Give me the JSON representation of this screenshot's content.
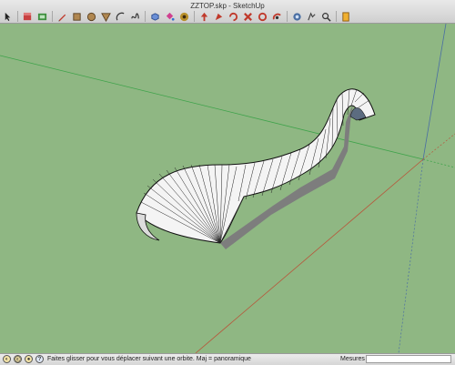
{
  "window": {
    "title": "ZZTOP.skp - SketchUp"
  },
  "toolbar": {
    "tools": [
      {
        "name": "select-tool-icon"
      },
      {
        "name": "eraser-tool-icon"
      },
      {
        "name": "make-component-icon"
      },
      {
        "name": "pencil-tool-icon"
      },
      {
        "name": "rectangle-tool-icon"
      },
      {
        "name": "circle-tool-icon"
      },
      {
        "name": "polygon-tool-icon"
      },
      {
        "name": "arc-tool-icon"
      },
      {
        "name": "freehand-tool-icon"
      },
      {
        "name": "push-pull-tool-icon"
      },
      {
        "name": "paint-bucket-tool-icon"
      },
      {
        "name": "move-tool-icon"
      },
      {
        "name": "push-pull-3d-tool-icon"
      },
      {
        "name": "follow-me-tool-icon"
      },
      {
        "name": "rotate-tool-icon"
      },
      {
        "name": "scale-tool-icon"
      },
      {
        "name": "offset-tool-icon"
      },
      {
        "name": "orbit-tool-icon"
      },
      {
        "name": "pan-tool-icon"
      },
      {
        "name": "zoom-tool-icon"
      },
      {
        "name": "section-tool-icon"
      }
    ]
  },
  "statusbar": {
    "message": "Faites glisser pour vous déplacer suivant une orbite.  Maj = panoramique",
    "measure_label": "Mesures",
    "measure_value": ""
  },
  "colors": {
    "ground": "#8fb783",
    "axis_green": "#3ea34a",
    "axis_red": "#b8553a",
    "axis_blue": "#4a6ea3"
  }
}
